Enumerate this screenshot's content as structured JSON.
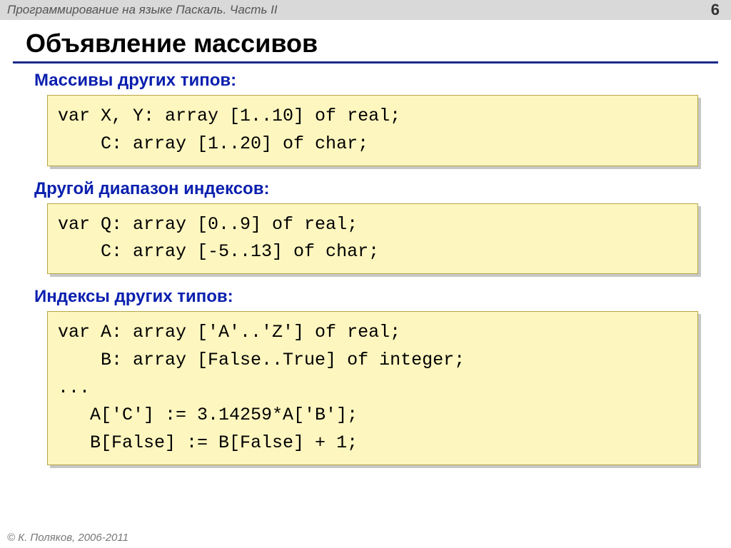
{
  "header": {
    "course": "Программирование на языке Паскаль. Часть II",
    "page": "6"
  },
  "title": "Объявление массивов",
  "sections": [
    {
      "heading": "Массивы других типов:",
      "code": "var X, Y: array [1..10] of real;\n    C: array [1..20] of char;"
    },
    {
      "heading": "Другой диапазон индексов:",
      "code": "var Q: array [0..9] of real;\n    C: array [-5..13] of char;"
    },
    {
      "heading": "Индексы других типов:",
      "code": "var A: array ['A'..'Z'] of real;\n    B: array [False..True] of integer;\n...\n   A['C'] := 3.14259*A['B'];\n   B[False] := B[False] + 1;"
    }
  ],
  "footer": "К. Поляков, 2006-2011",
  "copyright_symbol": "©"
}
